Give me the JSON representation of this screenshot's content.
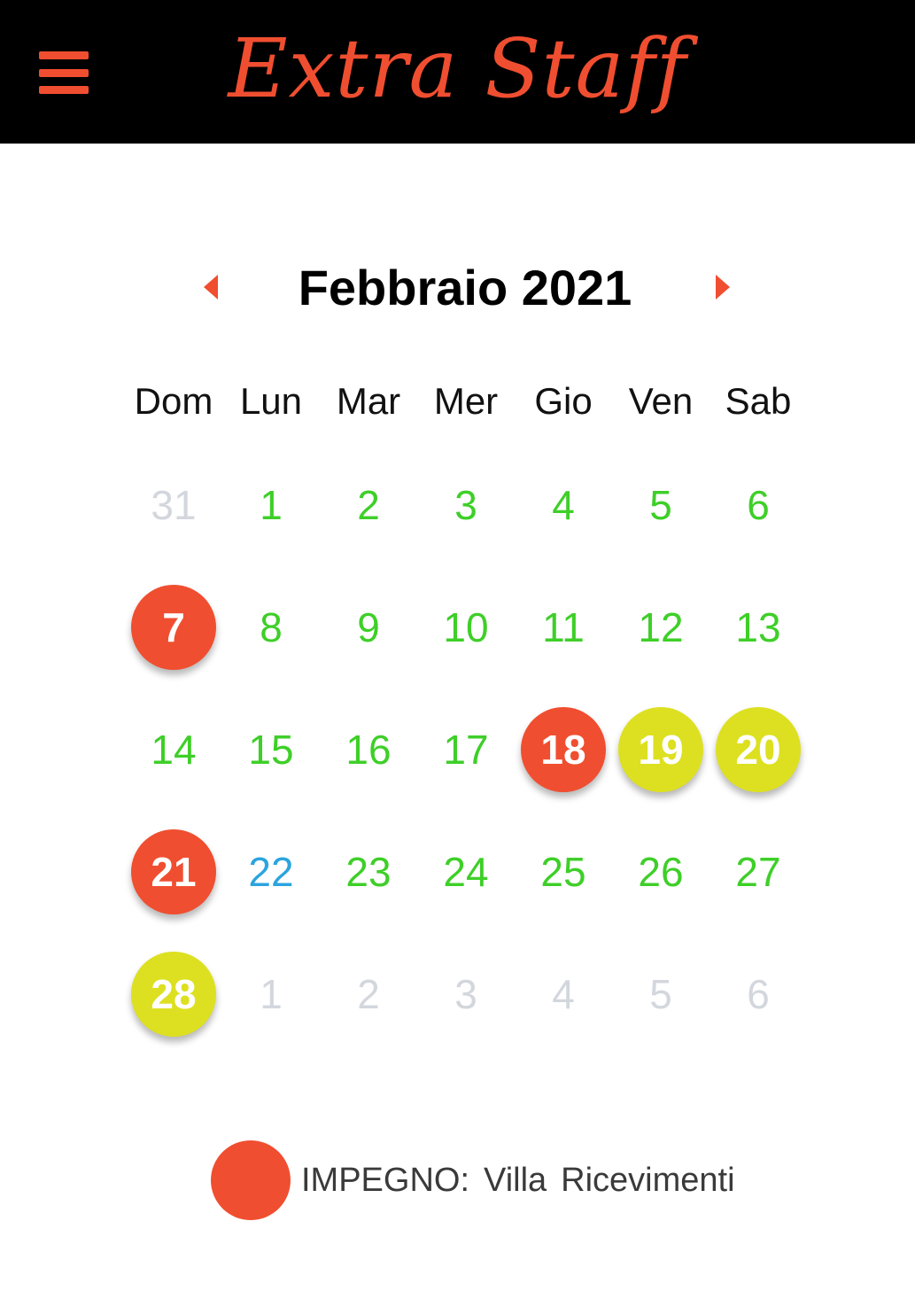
{
  "header": {
    "brand": "Extra Staff",
    "menu_icon": "hamburger-icon"
  },
  "colors": {
    "accent": "#f04e30",
    "busy": "#f04e30",
    "partial": "#dde020",
    "available": "#3ecf28",
    "today": "#2ba4de",
    "muted": "#d3d7dd"
  },
  "calendar": {
    "month_title": "Febbraio 2021",
    "prev_icon": "chevron-left-icon",
    "next_icon": "chevron-right-icon",
    "weekdays": [
      "Dom",
      "Lun",
      "Mar",
      "Mer",
      "Gio",
      "Ven",
      "Sab"
    ],
    "weeks": [
      [
        {
          "d": "31",
          "s": "muted"
        },
        {
          "d": "1",
          "s": "free"
        },
        {
          "d": "2",
          "s": "free"
        },
        {
          "d": "3",
          "s": "free"
        },
        {
          "d": "4",
          "s": "free"
        },
        {
          "d": "5",
          "s": "free"
        },
        {
          "d": "6",
          "s": "free"
        }
      ],
      [
        {
          "d": "7",
          "s": "red"
        },
        {
          "d": "8",
          "s": "free"
        },
        {
          "d": "9",
          "s": "free"
        },
        {
          "d": "10",
          "s": "free"
        },
        {
          "d": "11",
          "s": "free"
        },
        {
          "d": "12",
          "s": "free"
        },
        {
          "d": "13",
          "s": "free"
        }
      ],
      [
        {
          "d": "14",
          "s": "free"
        },
        {
          "d": "15",
          "s": "free"
        },
        {
          "d": "16",
          "s": "free"
        },
        {
          "d": "17",
          "s": "free"
        },
        {
          "d": "18",
          "s": "red"
        },
        {
          "d": "19",
          "s": "yellow"
        },
        {
          "d": "20",
          "s": "yellow"
        }
      ],
      [
        {
          "d": "21",
          "s": "red"
        },
        {
          "d": "22",
          "s": "today"
        },
        {
          "d": "23",
          "s": "free"
        },
        {
          "d": "24",
          "s": "free"
        },
        {
          "d": "25",
          "s": "free"
        },
        {
          "d": "26",
          "s": "free"
        },
        {
          "d": "27",
          "s": "free"
        }
      ],
      [
        {
          "d": "28",
          "s": "yellow"
        },
        {
          "d": "1",
          "s": "muted"
        },
        {
          "d": "2",
          "s": "muted"
        },
        {
          "d": "3",
          "s": "muted"
        },
        {
          "d": "4",
          "s": "muted"
        },
        {
          "d": "5",
          "s": "muted"
        },
        {
          "d": "6",
          "s": "muted"
        }
      ]
    ]
  },
  "legend": {
    "label": "IMPEGNO:",
    "words": [
      "Villa",
      "Ricevimenti"
    ]
  }
}
